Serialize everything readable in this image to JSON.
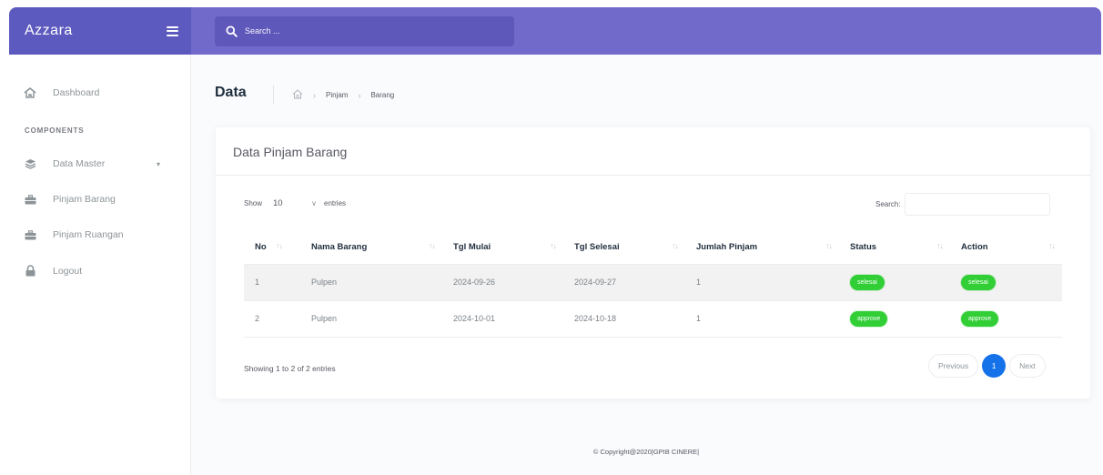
{
  "brand": "Azzara",
  "search": {
    "placeholder": "Search ..."
  },
  "sidebar": {
    "dashboard": "Dashboard",
    "section": "COMPONENTS",
    "items": [
      {
        "label": "Data Master",
        "icon": "layers-icon"
      },
      {
        "label": "Pinjam Barang",
        "icon": "briefcase-icon"
      },
      {
        "label": "Pinjam Ruangan",
        "icon": "briefcase-icon"
      },
      {
        "label": "Logout",
        "icon": "lock-icon"
      }
    ]
  },
  "page": {
    "title": "Data",
    "breadcrumb": [
      "Pinjam",
      "Barang"
    ]
  },
  "card": {
    "title": "Data Pinjam Barang",
    "show_label": "Show",
    "entries_value": "10",
    "entries_label": "entries",
    "search_label": "Search:"
  },
  "table": {
    "headers": [
      "No",
      "Nama Barang",
      "Tgl Mulai",
      "Tgl Selesai",
      "Jumlah Pinjam",
      "Status",
      "Action"
    ],
    "rows": [
      {
        "no": "1",
        "nama": "Pulpen",
        "mulai": "2024-09-26",
        "selesai": "2024-09-27",
        "jumlah": "1",
        "status": "selesai",
        "action": "selesai"
      },
      {
        "no": "2",
        "nama": "Pulpen",
        "mulai": "2024-10-01",
        "selesai": "2024-10-18",
        "jumlah": "1",
        "status": "approve",
        "action": "approve"
      }
    ]
  },
  "info": "Showing 1 to 2 of 2 entries",
  "pagination": {
    "previous": "Previous",
    "current": "1",
    "next": "Next"
  },
  "footer": "© Copyright@2020|GPIB CINERE|",
  "colors": {
    "header_dark": "#5d5abf",
    "header": "#716aca",
    "badge": "#31ce36",
    "page_active": "#1572e8"
  }
}
